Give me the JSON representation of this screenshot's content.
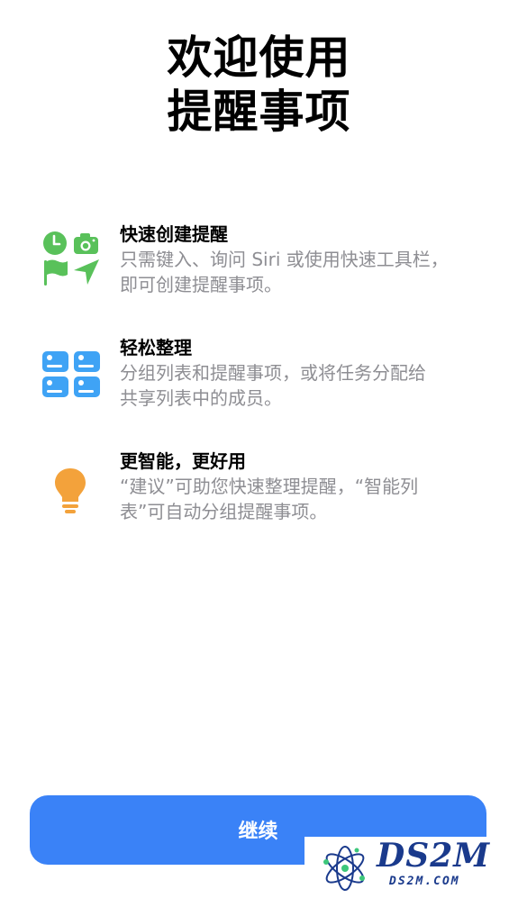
{
  "header": {
    "title_line1": "欢迎使用",
    "title_line2": "提醒事项"
  },
  "features": [
    {
      "title": "快速创建提醒",
      "desc_line1": "只需键入、询问 Siri 或使用快速工具栏，",
      "desc_line2": "即可创建提醒事项。",
      "icon": "quick-create-icons",
      "color": "#59c15a"
    },
    {
      "title": "轻松整理",
      "desc_line1": "分组列表和提醒事项，或将任务分配给",
      "desc_line2": "共享列表中的成员。",
      "icon": "grid-icon",
      "color": "#3fa3f5"
    },
    {
      "title": "更智能，更好用",
      "desc_line1": "“建议”可助您快速整理提醒，“智能列",
      "desc_line2": "表”可自动分组提醒事项。",
      "icon": "lightbulb-icon",
      "color": "#f3a23b"
    }
  ],
  "continue_button": {
    "label": "继续",
    "color": "#3a82f7"
  },
  "watermark": {
    "text_big": "DS2M",
    "text_small": "DS2M.COM"
  }
}
